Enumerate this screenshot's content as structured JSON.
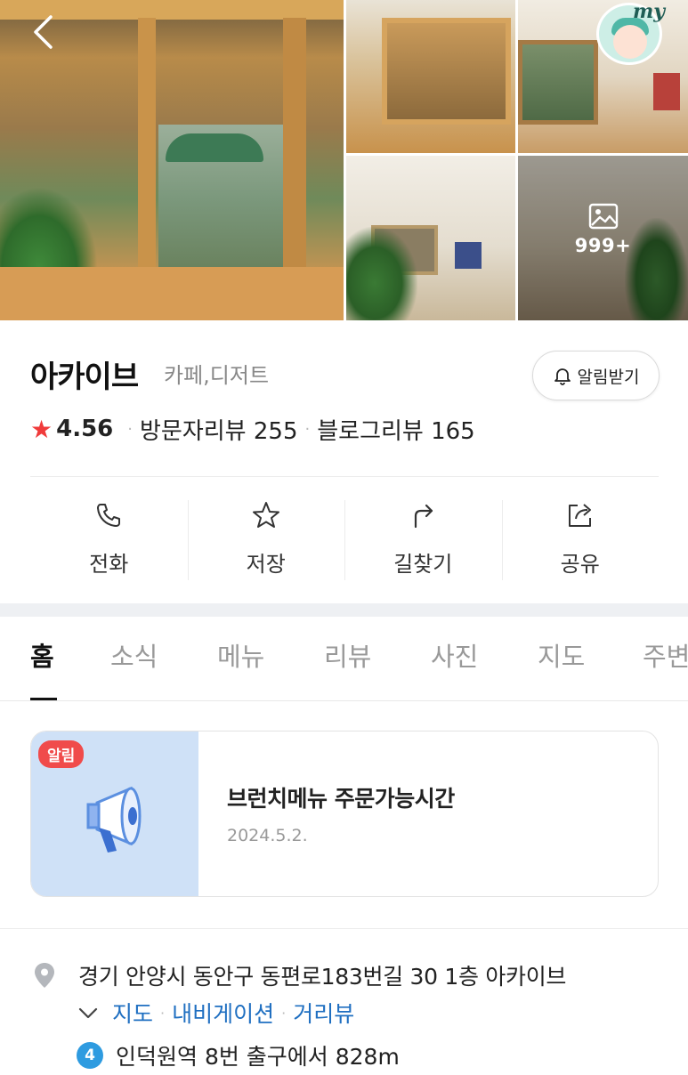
{
  "gallery": {
    "photo_count": "999+"
  },
  "avatar": {
    "text": "my"
  },
  "place": {
    "name": "아카이브",
    "category": "카페,디저트",
    "notify_label": "알림받기",
    "rating": "4.56",
    "visitor_reviews": "방문자리뷰 255",
    "blog_reviews": "블로그리뷰 165"
  },
  "actions": [
    {
      "label": "전화",
      "icon": "phone-icon"
    },
    {
      "label": "저장",
      "icon": "star-icon"
    },
    {
      "label": "길찾기",
      "icon": "directions-icon"
    },
    {
      "label": "공유",
      "icon": "share-icon"
    }
  ],
  "tabs": [
    {
      "label": "홈",
      "active": true
    },
    {
      "label": "소식",
      "active": false
    },
    {
      "label": "메뉴",
      "active": false
    },
    {
      "label": "리뷰",
      "active": false
    },
    {
      "label": "사진",
      "active": false
    },
    {
      "label": "지도",
      "active": false
    },
    {
      "label": "주변",
      "active": false
    }
  ],
  "notice": {
    "badge": "알림",
    "title": "브런치메뉴 주문가능시간",
    "date": "2024.5.2."
  },
  "address": {
    "text": "경기 안양시 동안구 동편로183번길 30 1층 아카이브",
    "links": [
      "지도",
      "내비게이션",
      "거리뷰"
    ],
    "subway_line": "4",
    "subway_text": "인덕원역 8번 출구에서 828m"
  },
  "colors": {
    "rating_star": "#f03b3b",
    "link_blue": "#1f6fc1",
    "notice_badge": "#f04b4b",
    "subway_line4": "#2e9be0",
    "notice_thumb_bg": "#cfe1f7"
  }
}
